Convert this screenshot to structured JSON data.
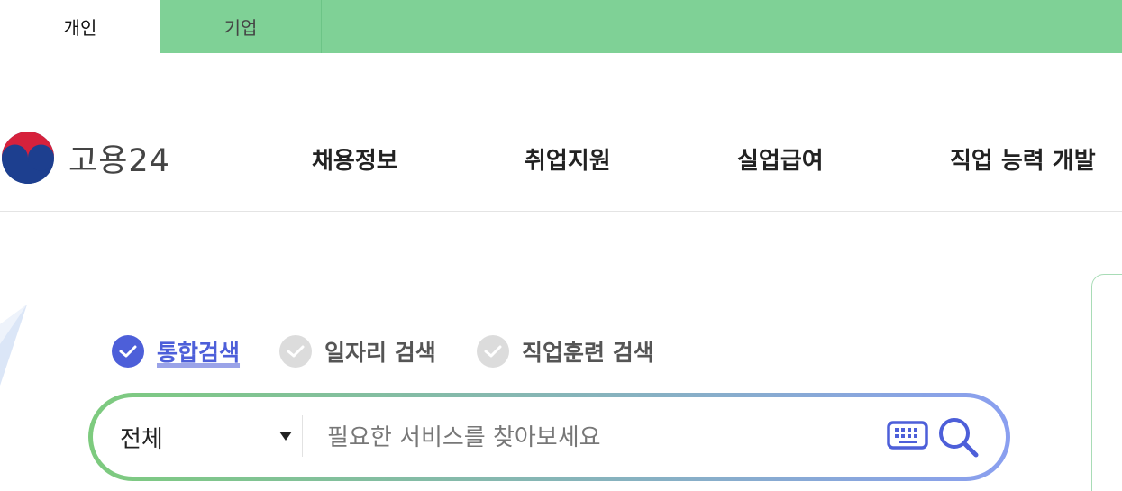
{
  "top_tabs": [
    {
      "label": "개인",
      "active": true
    },
    {
      "label": "기업",
      "active": false
    }
  ],
  "logo": {
    "text": "고용24",
    "emblem_icon": "taegeuk-emblem-icon"
  },
  "nav": [
    {
      "label": "채용정보"
    },
    {
      "label": "취업지원"
    },
    {
      "label": "실업급여"
    },
    {
      "label": "직업 능력 개발"
    }
  ],
  "search_types": [
    {
      "label": "통합검색",
      "selected": true
    },
    {
      "label": "일자리 검색",
      "selected": false
    },
    {
      "label": "직업훈련 검색",
      "selected": false
    }
  ],
  "search": {
    "category": "전체",
    "placeholder": "필요한 서비스를 찾아보세요",
    "keyboard_icon": "keyboard-icon",
    "search_icon": "search-icon"
  },
  "colors": {
    "top_bar": "#7fd196",
    "accent_blue": "#4d5fd9",
    "gradient_start": "#7dcb7e",
    "gradient_end": "#8a9ff0"
  }
}
